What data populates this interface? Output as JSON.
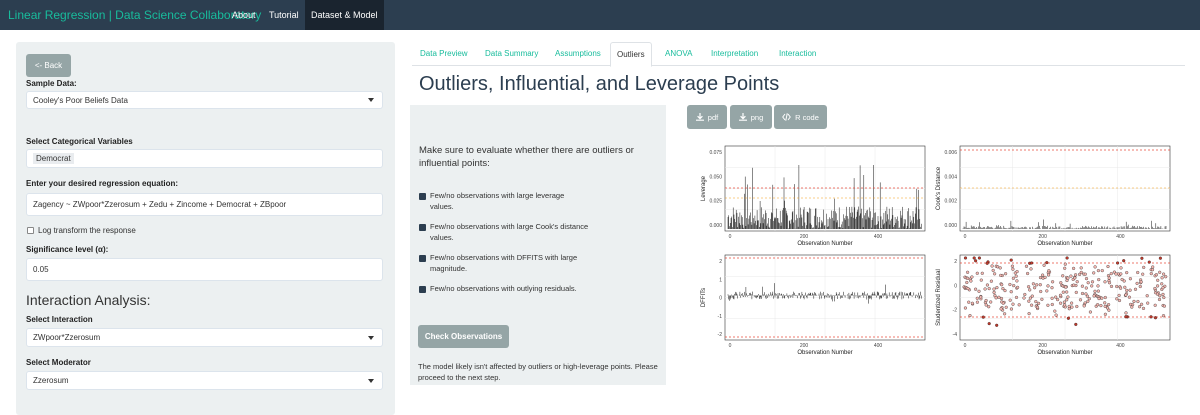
{
  "nav": {
    "brand": "Linear Regression | Data Science Collaboratory",
    "links": [
      "About",
      "Tutorial",
      "Dataset & Model"
    ]
  },
  "sidebar": {
    "back": "<- Back",
    "sample_label": "Sample Data:",
    "sample_value": "Cooley's Poor Beliefs Data",
    "cat_label": "Select Categorical Variables",
    "cat_value": "Democrat",
    "eq_label": "Enter your desired regression equation:",
    "eq_value": "Zagency ~ ZWpoor*Zzerosum + Zedu + Zincome + Democrat + ZBpoor",
    "log_label": "Log transform the response",
    "sig_label": "Significance level (α):",
    "sig_value": "0.05",
    "interaction_heading": "Interaction Analysis:",
    "interaction_label": "Select Interaction",
    "interaction_value": "ZWpoor*Zzerosum",
    "moderator_label": "Select Moderator",
    "moderator_value": "Zzerosum"
  },
  "tabs": [
    "Data Preview",
    "Data Summary",
    "Assumptions",
    "Outliers",
    "ANOVA",
    "Interpretation",
    "Interaction"
  ],
  "active_tab": "Outliers",
  "main": {
    "title": "Outliers, Influential, and Leverage Points",
    "instruction": "Make sure to evaluate whether there are outliers or influential points:",
    "checklist": [
      "Few/no observations with large leverage values.",
      "Few/no observations with large Cook's distance values.",
      "Few/no observations with DFFITS with large magnitude.",
      "Few/no observations with outlying residuals."
    ],
    "check_button": "Check Observations",
    "result": "The model likely isn't affected by outliers or high-leverage points. Please proceed to the next step.",
    "downloads": [
      "pdf",
      "png",
      "R code"
    ]
  },
  "plots": {
    "leverage": {
      "ylabel": "Leverage",
      "xlabel": "Observation Number",
      "yticks": [
        "0.075",
        "0.050",
        "0.025",
        "0.000"
      ],
      "xticks": [
        "0",
        "200",
        "400"
      ]
    },
    "cooks": {
      "ylabel": "Cook's Distance",
      "xlabel": "Observation Number",
      "yticks": [
        "0.006",
        "0.004",
        "0.002",
        "0.000"
      ],
      "xticks": [
        "0",
        "200",
        "400"
      ]
    },
    "dffits": {
      "ylabel": "DFFITs",
      "xlabel": "Observation Number",
      "yticks": [
        "2",
        "1",
        "0",
        "-1",
        "-2"
      ],
      "xticks": [
        "0",
        "200",
        "400"
      ]
    },
    "resid": {
      "ylabel": "Studentized Residual",
      "xlabel": "Observation Number",
      "yticks": [
        "2",
        "0",
        "-2",
        "-4"
      ],
      "xticks": [
        "0",
        "200",
        "400"
      ]
    }
  },
  "colors": {
    "navbar": "#2c3e50",
    "brand": "#18bc9c",
    "button": "#95a5a6",
    "panel": "#ecf0f1",
    "threshold": "#e74c3c"
  }
}
